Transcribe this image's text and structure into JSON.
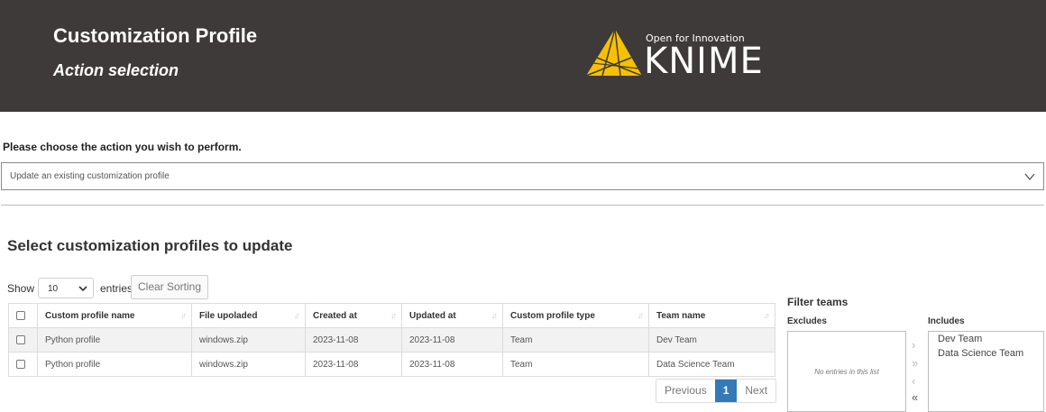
{
  "header": {
    "title": "Customization Profile",
    "subtitle": "Action selection",
    "logo_tagline": "Open for Innovation",
    "logo_word": "KNIME",
    "logo_accent": "#f7c000"
  },
  "action": {
    "prompt": "Please choose the action you wish to perform.",
    "selected": "Update an existing customization profile"
  },
  "section": {
    "title": "Select customization profiles to update"
  },
  "table_controls": {
    "show_label": "Show",
    "page_length": "10",
    "entries_label": "entries",
    "clear_sorting": "Clear Sorting"
  },
  "table": {
    "columns": [
      "Custom profile name",
      "File upoladed",
      "Created at",
      "Updated at",
      "Custom profile type",
      "Team name"
    ],
    "rows": [
      [
        "Python profile",
        "windows.zip",
        "2023-11-08",
        "2023-11-08",
        "Team",
        "Dev Team"
      ],
      [
        "Python profile",
        "windows.zip",
        "2023-11-08",
        "2023-11-08",
        "Team",
        "Data Science Team"
      ]
    ]
  },
  "pagination": {
    "previous": "Previous",
    "current": "1",
    "next": "Next"
  },
  "filter": {
    "title": "Filter teams",
    "excludes_label": "Excludes",
    "includes_label": "Includes",
    "excludes_empty": "No entries in this list",
    "includes": [
      "Dev Team",
      "Data Science Team"
    ]
  }
}
